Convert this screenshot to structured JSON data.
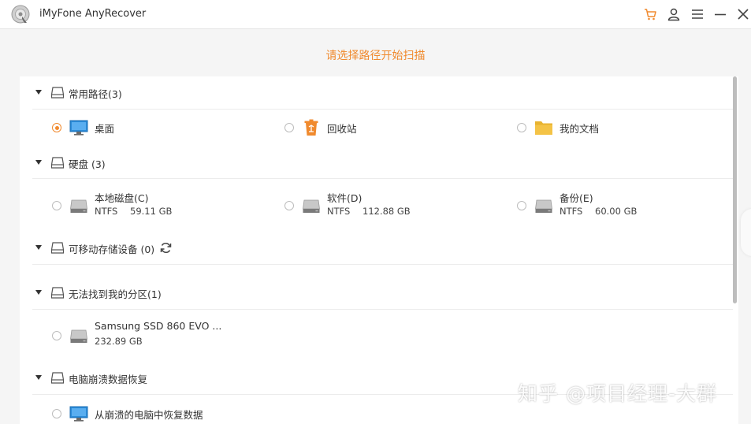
{
  "app": {
    "title": "iMyFone AnyRecover"
  },
  "colors": {
    "accent": "#f08a2e",
    "monitor": "#2b8bd8",
    "folder": "#f4c346",
    "bin": "#f08a2e"
  },
  "toolbar": {
    "icons": [
      "cart-icon",
      "user-icon",
      "menu-icon",
      "minimize-icon",
      "close-icon"
    ]
  },
  "heading": "请选择路径开始扫描",
  "sections": {
    "common": {
      "title": "常用路径(3)",
      "items": [
        {
          "label": "桌面",
          "icon": "desktop-icon",
          "selected": true
        },
        {
          "label": "回收站",
          "icon": "recycle-bin-icon",
          "selected": false
        },
        {
          "label": "我的文档",
          "icon": "folder-icon",
          "selected": false
        }
      ]
    },
    "disks": {
      "title": "硬盘 (3)",
      "items": [
        {
          "name": "本地磁盘(C)",
          "fs": "NTFS",
          "size": "59.11 GB"
        },
        {
          "name": "软件(D)",
          "fs": "NTFS",
          "size": "112.88 GB"
        },
        {
          "name": "备份(E)",
          "fs": "NTFS",
          "size": "60.00 GB"
        }
      ]
    },
    "removable": {
      "title": "可移动存储设备 (0)"
    },
    "lost": {
      "title": "无法找到我的分区(1)",
      "items": [
        {
          "name": "Samsung SSD 860 EVO ...",
          "size": "232.89 GB"
        }
      ]
    },
    "crash": {
      "title": "电脑崩溃数据恢复",
      "items": [
        {
          "label": "从崩溃的电脑中恢复数据"
        }
      ]
    }
  },
  "watermark": "知乎 @项目经理-大群"
}
